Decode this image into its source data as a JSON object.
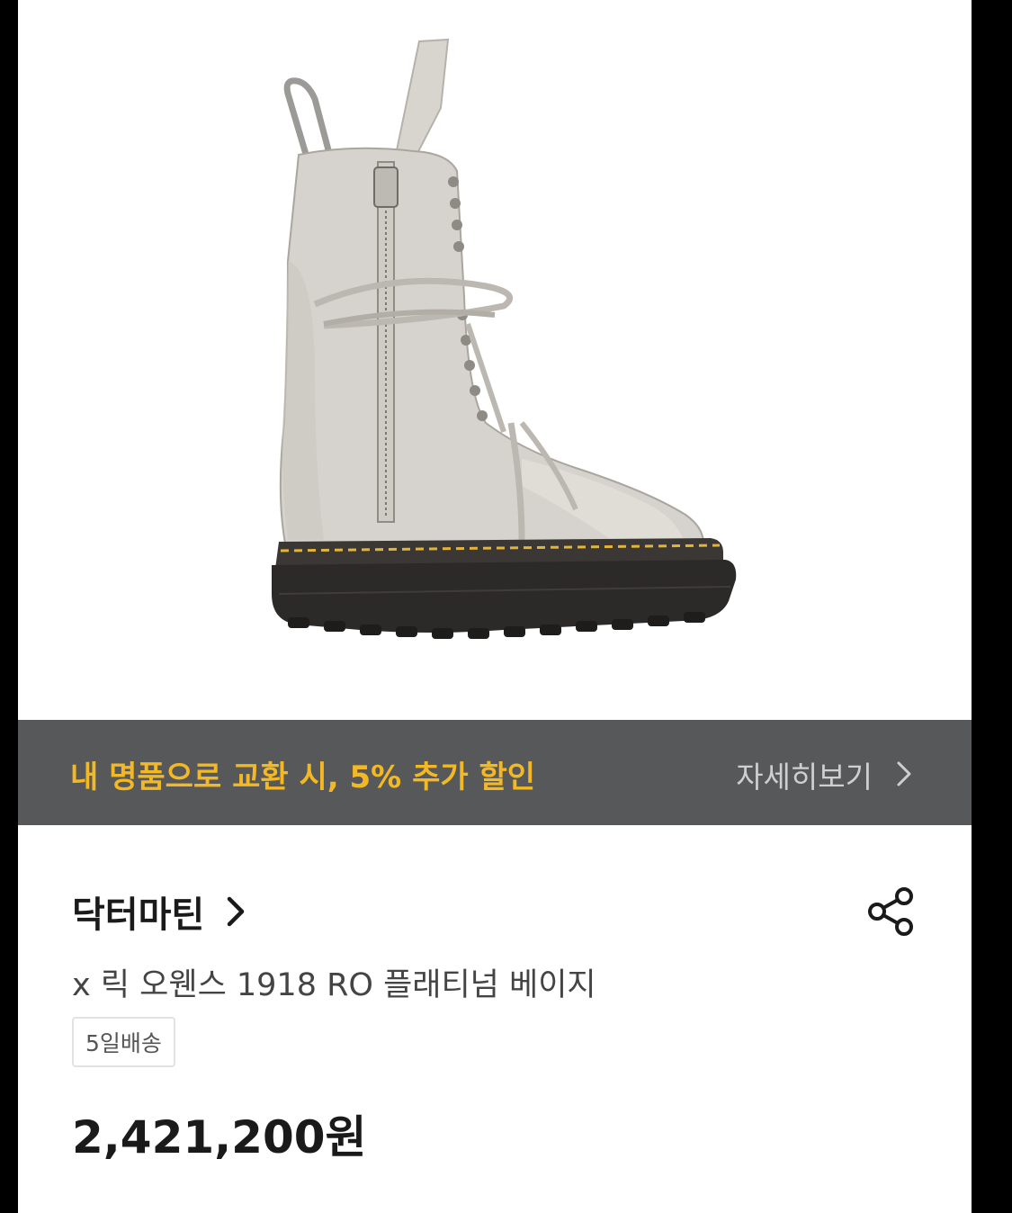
{
  "colors": {
    "background": "#ffffff",
    "page_frame": "#000000",
    "banner_bg": "#57585a",
    "banner_accent": "#f2b825",
    "banner_link": "#cfcfcf",
    "text_primary": "#1a1a1a",
    "text_secondary": "#444444",
    "boot_upper": "#d6d3ce",
    "boot_sole": "#2c2a28",
    "boot_stitch": "#e2b43a"
  },
  "product_image": {
    "alt": "boot-product-photo"
  },
  "promo_banner": {
    "text": "내 명품으로 교환 시, 5% 추가 할인",
    "link_label": "자세히보기",
    "link_icon": "chevron-right-icon"
  },
  "product": {
    "brand": "닥터마틴",
    "brand_icon": "chevron-right-icon",
    "share_icon": "share-icon",
    "name": "x 릭 오웬스 1918 RO 플래티넘 베이지",
    "shipping_badge": "5일배송",
    "price": "2,421,200원"
  }
}
